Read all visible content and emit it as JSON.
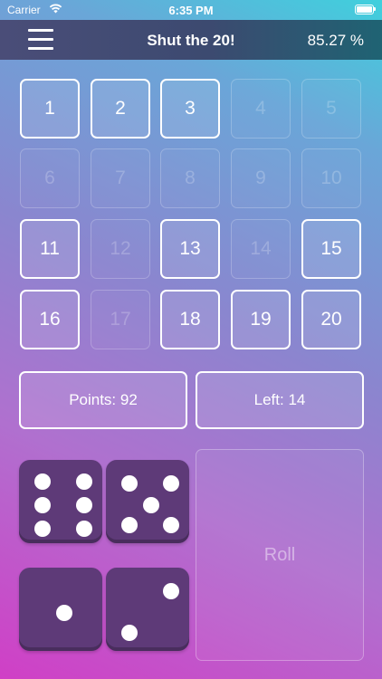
{
  "status_bar": {
    "carrier": "Carrier",
    "time": "6:35 PM"
  },
  "nav": {
    "title": "Shut the 20!",
    "percent": "85.27 %"
  },
  "tiles": [
    {
      "label": "1",
      "open": true
    },
    {
      "label": "2",
      "open": true
    },
    {
      "label": "3",
      "open": true
    },
    {
      "label": "4",
      "open": false
    },
    {
      "label": "5",
      "open": false
    },
    {
      "label": "6",
      "open": false
    },
    {
      "label": "7",
      "open": false
    },
    {
      "label": "8",
      "open": false
    },
    {
      "label": "9",
      "open": false
    },
    {
      "label": "10",
      "open": false
    },
    {
      "label": "11",
      "open": true
    },
    {
      "label": "12",
      "open": false
    },
    {
      "label": "13",
      "open": true
    },
    {
      "label": "14",
      "open": false
    },
    {
      "label": "15",
      "open": true
    },
    {
      "label": "16",
      "open": true
    },
    {
      "label": "17",
      "open": false
    },
    {
      "label": "18",
      "open": true
    },
    {
      "label": "19",
      "open": true
    },
    {
      "label": "20",
      "open": true
    }
  ],
  "score": {
    "points_label": "Points: 92",
    "left_label": "Left: 14"
  },
  "dice": [
    6,
    5,
    1,
    2
  ],
  "roll_label": "Roll"
}
